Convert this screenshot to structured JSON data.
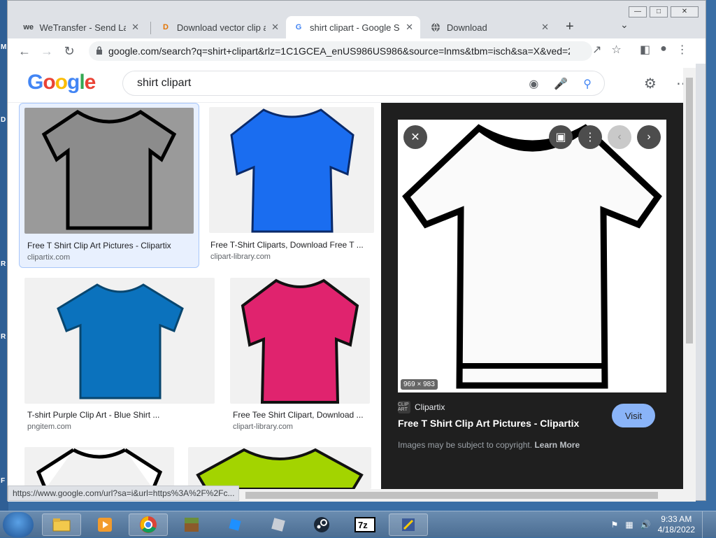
{
  "browser": {
    "tabs": [
      {
        "label": "WeTransfer - Send Large",
        "favicon": "we"
      },
      {
        "label": "Download vector clip art",
        "favicon": "D"
      },
      {
        "label": "shirt clipart - Google Se",
        "favicon": "G"
      },
      {
        "label": "Download",
        "favicon": "globe"
      }
    ],
    "url": "google.com/search?q=shirt+clipart&rlz=1C1GCEA_enUS986US986&source=lnms&tbm=isch&sa=X&ved=2...",
    "status_url": "https://www.google.com/url?sa=i&url=https%3A%2F%2Fc..."
  },
  "google": {
    "logo": "Google",
    "query": "shirt clipart"
  },
  "results": [
    {
      "caption": "Free T Shirt Clip Art Pictures - Clipartix",
      "source": "clipartix.com",
      "color": "#8f8f8f"
    },
    {
      "caption": "Free T-Shirt Cliparts, Download Free T ...",
      "source": "clipart-library.com",
      "color": "#1a6df0"
    },
    {
      "caption": "T-shirt Purple Clip Art - Blue Shirt ...",
      "source": "pngitem.com",
      "color": "#0b72bd"
    },
    {
      "caption": "Free Tee Shirt Clipart, Download ...",
      "source": "clipart-library.com",
      "color": "#e0236e"
    },
    {
      "caption": "",
      "source": "",
      "color": "#ffffff"
    },
    {
      "caption": "",
      "source": "",
      "color": "#a3d400"
    }
  ],
  "preview": {
    "dimensions": "969 × 983",
    "site": "Clipartix",
    "site_icon_text": "CLIP ART",
    "title": "Free T Shirt Clip Art Pictures - Clipartix",
    "visit_label": "Visit",
    "copyright_text": "Images may be subject to copyright.",
    "learn_more": "Learn More"
  },
  "taskbar": {
    "time": "9:33 AM",
    "date": "4/18/2022"
  },
  "desktop_strip": [
    "M",
    "D",
    "R",
    "R",
    "F"
  ],
  "colors": {
    "accent": "#1a73e8",
    "visit_button": "#8ab4f8",
    "panel_bg": "#1f1f1f"
  }
}
